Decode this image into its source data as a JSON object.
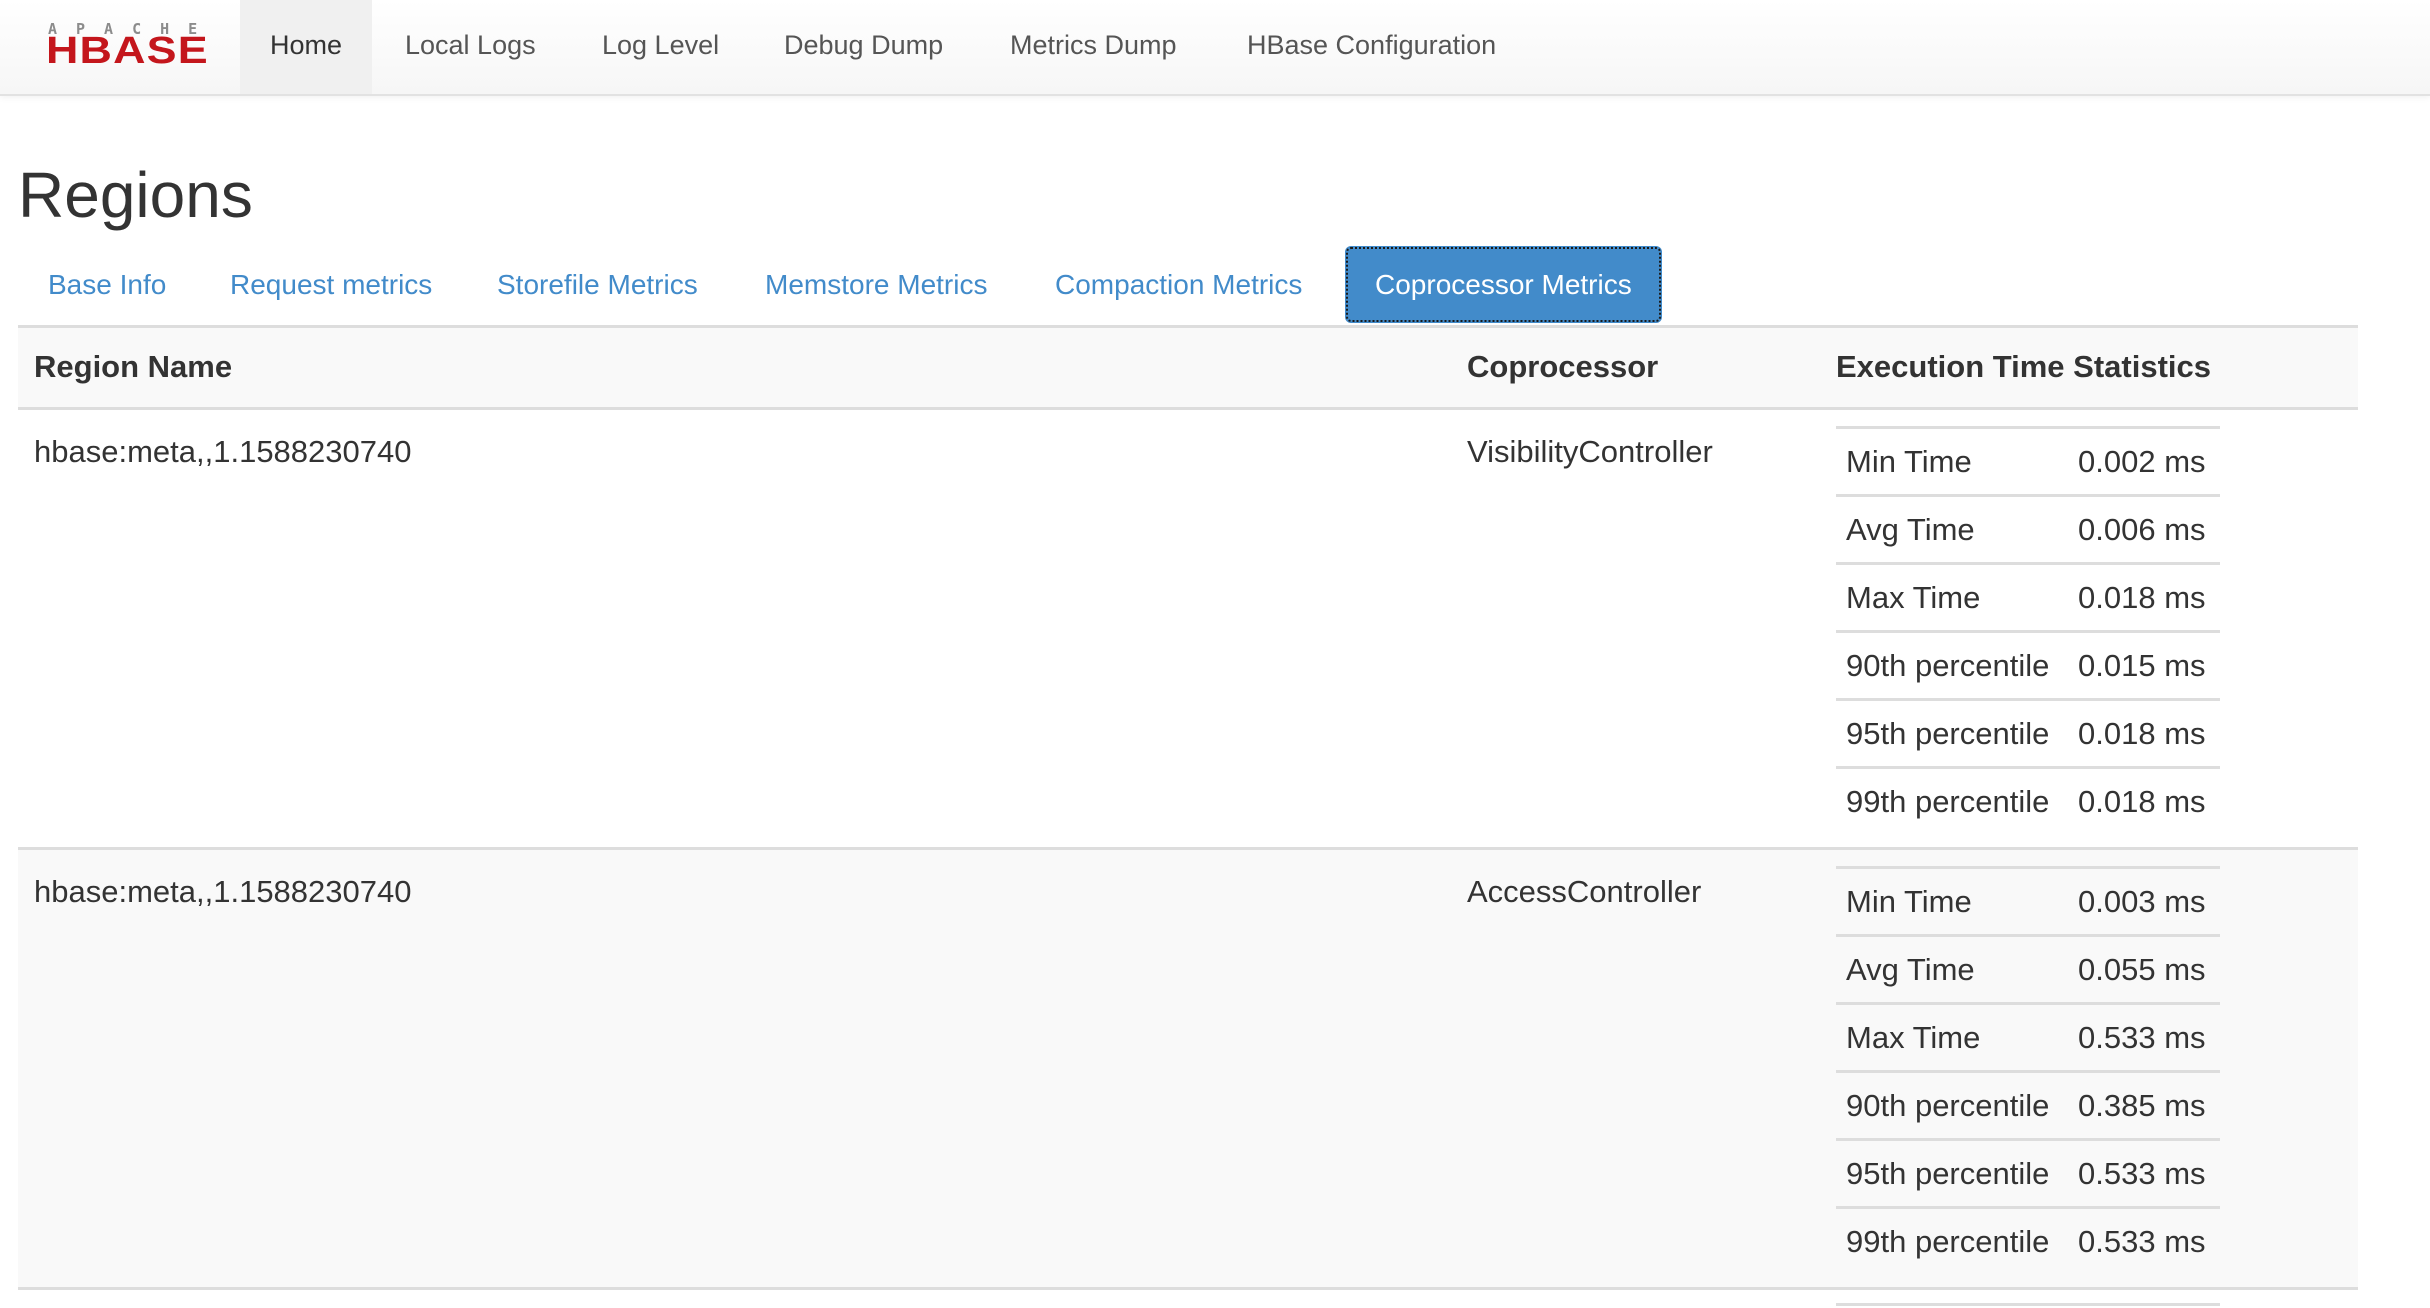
{
  "navbar": {
    "logo": {
      "top_text": "APACHE",
      "main_text": "HBASE"
    },
    "items": [
      {
        "label": "Home",
        "active": true
      },
      {
        "label": "Local Logs",
        "active": false
      },
      {
        "label": "Log Level",
        "active": false
      },
      {
        "label": "Debug Dump",
        "active": false
      },
      {
        "label": "Metrics Dump",
        "active": false
      },
      {
        "label": "HBase Configuration",
        "active": false
      }
    ]
  },
  "page": {
    "title": "Regions"
  },
  "tabs": [
    {
      "label": "Base Info",
      "active": false
    },
    {
      "label": "Request metrics",
      "active": false
    },
    {
      "label": "Storefile Metrics",
      "active": false
    },
    {
      "label": "Memstore Metrics",
      "active": false
    },
    {
      "label": "Compaction Metrics",
      "active": false
    },
    {
      "label": "Coprocessor Metrics",
      "active": true
    }
  ],
  "table": {
    "headers": [
      "Region Name",
      "Coprocessor",
      "Execution Time Statistics"
    ],
    "rows": [
      {
        "region_name": "hbase:meta,,1.1588230740",
        "coprocessor": "VisibilityController",
        "stats": [
          {
            "label": "Min Time",
            "value": "0.002 ms"
          },
          {
            "label": "Avg Time",
            "value": "0.006 ms"
          },
          {
            "label": "Max Time",
            "value": "0.018 ms"
          },
          {
            "label": "90th percentile",
            "value": "0.015 ms"
          },
          {
            "label": "95th percentile",
            "value": "0.018 ms"
          },
          {
            "label": "99th percentile",
            "value": "0.018 ms"
          }
        ]
      },
      {
        "region_name": "hbase:meta,,1.1588230740",
        "coprocessor": "AccessController",
        "stats": [
          {
            "label": "Min Time",
            "value": "0.003 ms"
          },
          {
            "label": "Avg Time",
            "value": "0.055 ms"
          },
          {
            "label": "Max Time",
            "value": "0.533 ms"
          },
          {
            "label": "90th percentile",
            "value": "0.385 ms"
          },
          {
            "label": "95th percentile",
            "value": "0.533 ms"
          },
          {
            "label": "99th percentile",
            "value": "0.533 ms"
          }
        ]
      }
    ]
  },
  "colors": {
    "brand_red": "#c4161c",
    "link_blue": "#428bca",
    "active_tab_bg": "#428bca",
    "text": "#333333"
  }
}
